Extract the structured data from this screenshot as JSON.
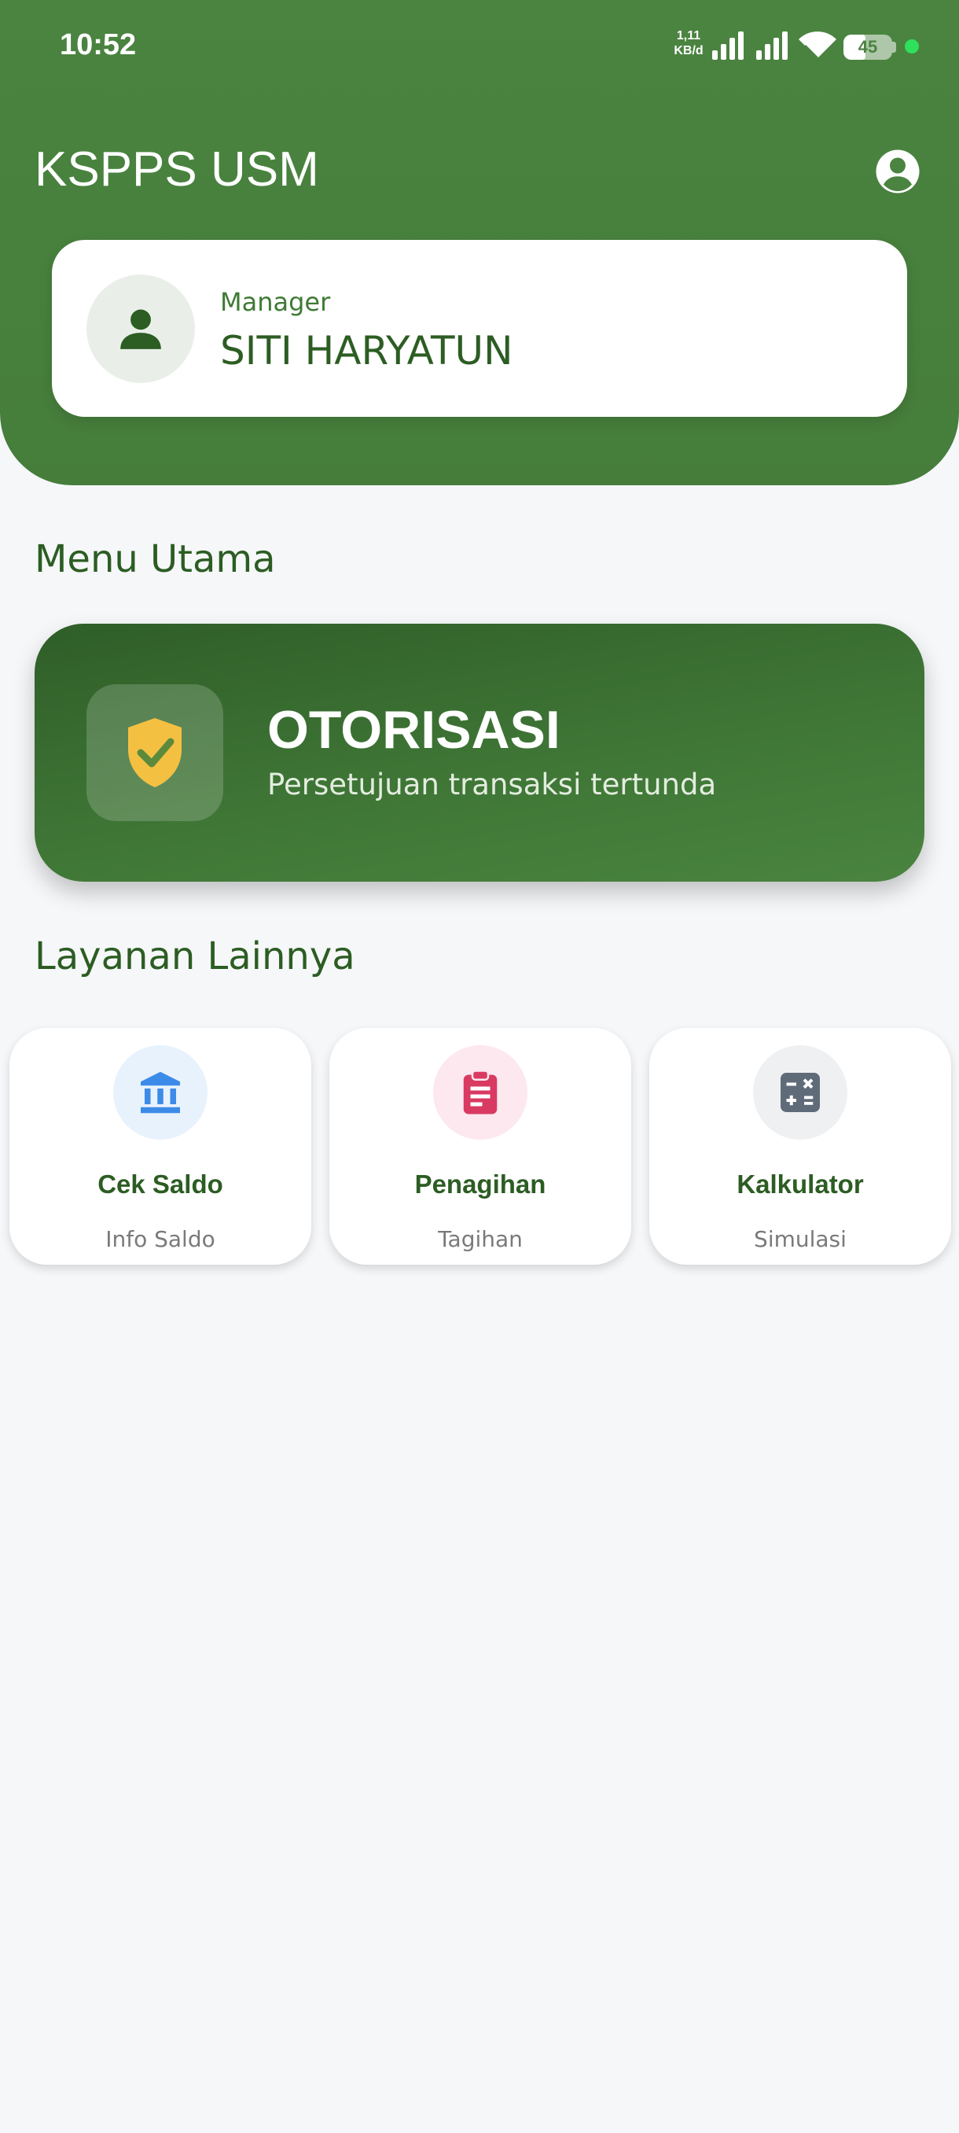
{
  "status_bar": {
    "time": "10:52",
    "net_speed_value": "1,11",
    "net_speed_unit": "KB/d",
    "battery": "45",
    "battery_level": 0.45
  },
  "header": {
    "title": "KSPPS USM",
    "user": {
      "role": "Manager",
      "name": "SITI HARYATUN"
    }
  },
  "main": {
    "menu_title": "Menu Utama",
    "authorization": {
      "title": "OTORISASI",
      "subtitle": "Persetujuan transaksi tertunda",
      "icon": "shield-check-icon"
    },
    "services_title": "Layanan Lainnya",
    "services": [
      {
        "label": "Cek Saldo",
        "sub": "Info Saldo",
        "icon": "bank-icon",
        "color": "#3d8be8",
        "bg": "#e8f2fd"
      },
      {
        "label": "Penagihan",
        "sub": "Tagihan",
        "icon": "clipboard-icon",
        "color": "#d93a62",
        "bg": "#fce8ee"
      },
      {
        "label": "Kalkulator",
        "sub": "Simulasi",
        "icon": "calculator-icon",
        "color": "#5f6b78",
        "bg": "#eef0f2"
      }
    ]
  },
  "colors": {
    "primary": "#4a8440",
    "primary_dark": "#2c5d23",
    "accent_yellow": "#f4c042",
    "background": "#f6f7f9"
  }
}
